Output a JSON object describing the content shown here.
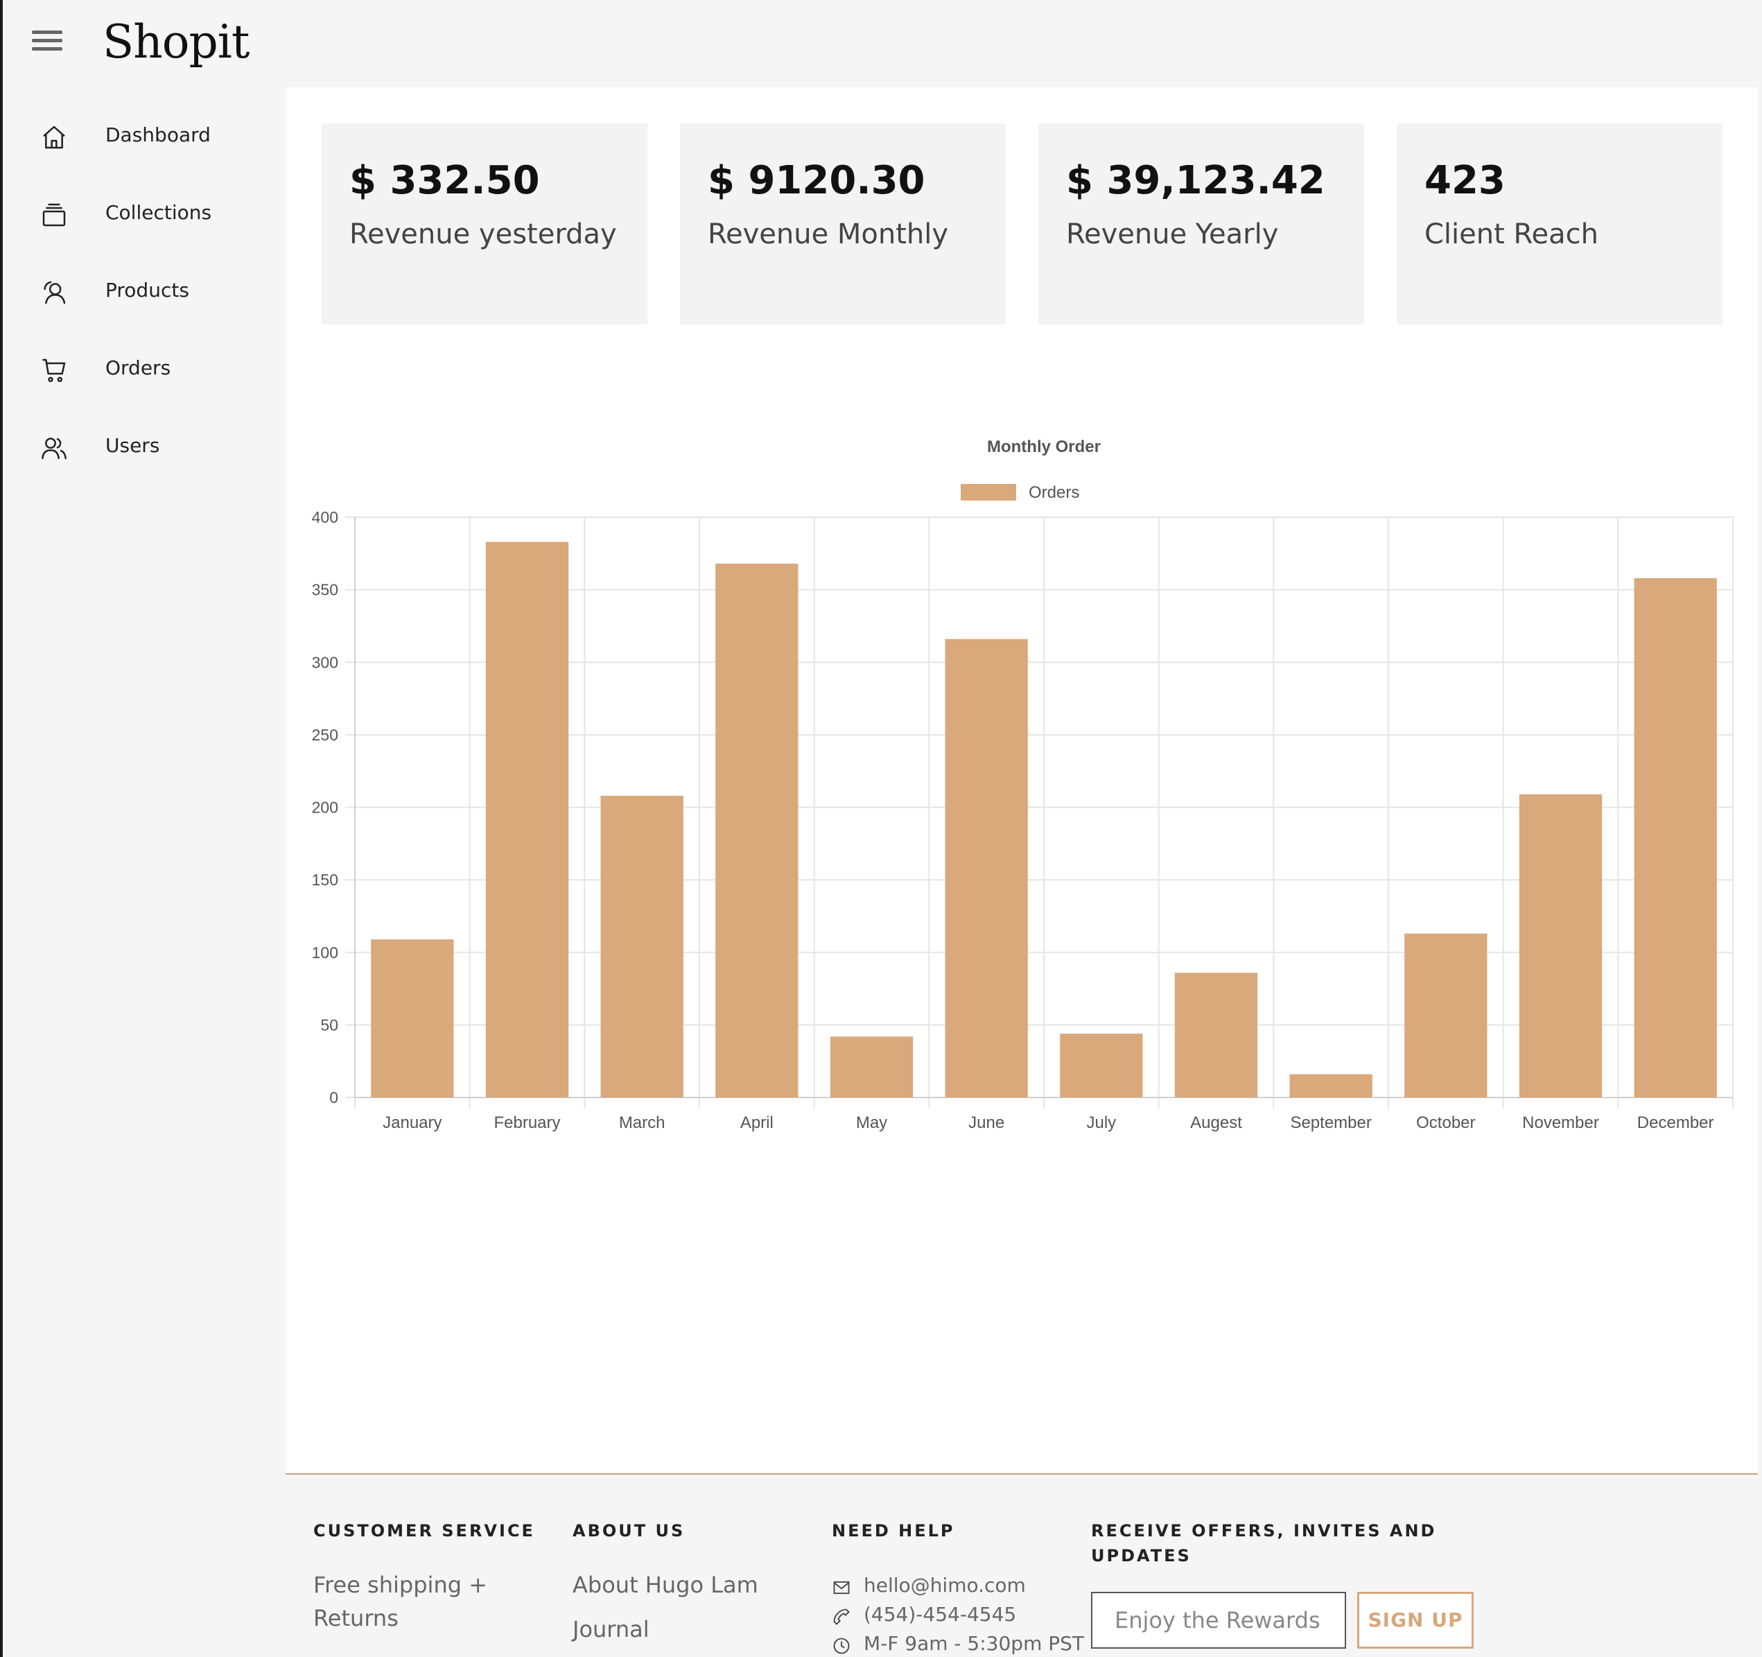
{
  "app": {
    "name": "Shopit"
  },
  "sidebar": {
    "items": [
      {
        "label": "Dashboard",
        "icon": "home-icon"
      },
      {
        "label": "Collections",
        "icon": "collections-icon"
      },
      {
        "label": "Products",
        "icon": "products-icon"
      },
      {
        "label": "Orders",
        "icon": "cart-icon"
      },
      {
        "label": "Users",
        "icon": "users-icon"
      }
    ]
  },
  "stats": [
    {
      "value": "$ 332.50",
      "label": "Revenue yesterday"
    },
    {
      "value": "$ 9120.30",
      "label": "Revenue Monthly"
    },
    {
      "value": "$ 39,123.42",
      "label": "Revenue Yearly"
    },
    {
      "value": "423",
      "label": "Client Reach"
    }
  ],
  "chart_data": {
    "type": "bar",
    "title": "Monthly Order",
    "categories": [
      "January",
      "February",
      "March",
      "April",
      "May",
      "June",
      "July",
      "Augest",
      "September",
      "October",
      "November",
      "December"
    ],
    "series": [
      {
        "name": "Orders",
        "values": [
          109,
          383,
          208,
          368,
          42,
          316,
          44,
          86,
          16,
          113,
          209,
          358
        ]
      }
    ],
    "ylim": [
      0,
      400
    ],
    "yticks": [
      0,
      50,
      100,
      150,
      200,
      250,
      300,
      350,
      400
    ],
    "grid": true,
    "legend": "top-center",
    "colors": {
      "bar": "#d9a87b",
      "grid": "#e5e5e5",
      "text": "#555555"
    }
  },
  "footer": {
    "customer_service": {
      "title": "CUSTOMER SERVICE",
      "links": [
        "Free shipping +",
        "Returns"
      ]
    },
    "about_us": {
      "title": "ABOUT US",
      "links": [
        "About Hugo Lam",
        "Journal"
      ]
    },
    "need_help": {
      "title": "NEED HELP",
      "email": "hello@himo.com",
      "phone": "(454)-454-4545",
      "hours": "M-F 9am - 5:30pm PST"
    },
    "newsletter": {
      "title_line1": "RECEIVE OFFERS, INVITES AND",
      "title_line2": "UPDATES",
      "placeholder": "Enjoy the Rewards",
      "button": "SIGN UP"
    }
  },
  "colors": {
    "accent": "#d9a87b",
    "background": "#f5f5f5",
    "panel": "#ffffff",
    "card": "#f3f3f3"
  }
}
